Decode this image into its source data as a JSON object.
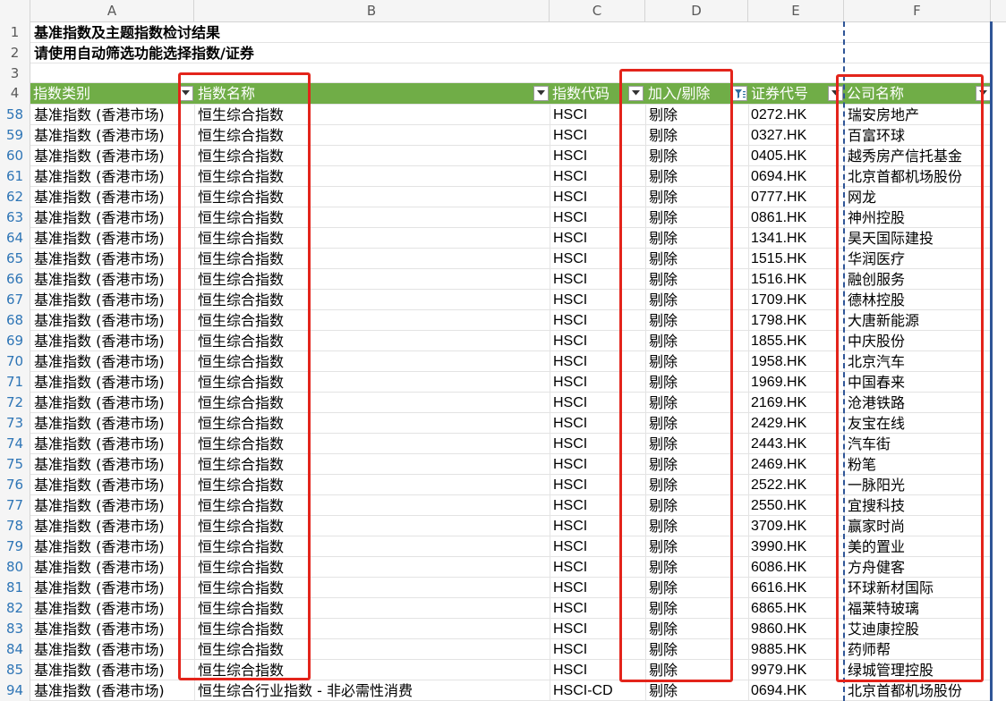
{
  "columns": [
    "A",
    "B",
    "C",
    "D",
    "E",
    "F"
  ],
  "title_rows": [
    {
      "num": "1",
      "text": "基准指数及主题指数检讨结果"
    },
    {
      "num": "2",
      "text": "请使用自动筛选功能选择指数/证券"
    },
    {
      "num": "3",
      "text": ""
    }
  ],
  "header": {
    "num": "4",
    "cells": [
      "指数类别",
      "指数名称",
      "指数代码",
      "加入/剔除",
      "证券代号",
      "公司名称"
    ],
    "filtered_column_index": 3
  },
  "rows": [
    {
      "num": "58",
      "category": "基准指数 (香港市场)",
      "index_name": "恒生综合指数",
      "index_code": "HSCI",
      "action": "剔除",
      "security_code": "0272.HK",
      "company": "瑞安房地产"
    },
    {
      "num": "59",
      "category": "基准指数 (香港市场)",
      "index_name": "恒生综合指数",
      "index_code": "HSCI",
      "action": "剔除",
      "security_code": "0327.HK",
      "company": "百富环球"
    },
    {
      "num": "60",
      "category": "基准指数 (香港市场)",
      "index_name": "恒生综合指数",
      "index_code": "HSCI",
      "action": "剔除",
      "security_code": "0405.HK",
      "company": "越秀房产信托基金"
    },
    {
      "num": "61",
      "category": "基准指数 (香港市场)",
      "index_name": "恒生综合指数",
      "index_code": "HSCI",
      "action": "剔除",
      "security_code": "0694.HK",
      "company": "北京首都机场股份"
    },
    {
      "num": "62",
      "category": "基准指数 (香港市场)",
      "index_name": "恒生综合指数",
      "index_code": "HSCI",
      "action": "剔除",
      "security_code": "0777.HK",
      "company": "网龙"
    },
    {
      "num": "63",
      "category": "基准指数 (香港市场)",
      "index_name": "恒生综合指数",
      "index_code": "HSCI",
      "action": "剔除",
      "security_code": "0861.HK",
      "company": "神州控股"
    },
    {
      "num": "64",
      "category": "基准指数 (香港市场)",
      "index_name": "恒生综合指数",
      "index_code": "HSCI",
      "action": "剔除",
      "security_code": "1341.HK",
      "company": "昊天国际建投"
    },
    {
      "num": "65",
      "category": "基准指数 (香港市场)",
      "index_name": "恒生综合指数",
      "index_code": "HSCI",
      "action": "剔除",
      "security_code": "1515.HK",
      "company": "华润医疗"
    },
    {
      "num": "66",
      "category": "基准指数 (香港市场)",
      "index_name": "恒生综合指数",
      "index_code": "HSCI",
      "action": "剔除",
      "security_code": "1516.HK",
      "company": "融创服务"
    },
    {
      "num": "67",
      "category": "基准指数 (香港市场)",
      "index_name": "恒生综合指数",
      "index_code": "HSCI",
      "action": "剔除",
      "security_code": "1709.HK",
      "company": "德林控股"
    },
    {
      "num": "68",
      "category": "基准指数 (香港市场)",
      "index_name": "恒生综合指数",
      "index_code": "HSCI",
      "action": "剔除",
      "security_code": "1798.HK",
      "company": "大唐新能源"
    },
    {
      "num": "69",
      "category": "基准指数 (香港市场)",
      "index_name": "恒生综合指数",
      "index_code": "HSCI",
      "action": "剔除",
      "security_code": "1855.HK",
      "company": "中庆股份"
    },
    {
      "num": "70",
      "category": "基准指数 (香港市场)",
      "index_name": "恒生综合指数",
      "index_code": "HSCI",
      "action": "剔除",
      "security_code": "1958.HK",
      "company": "北京汽车"
    },
    {
      "num": "71",
      "category": "基准指数 (香港市场)",
      "index_name": "恒生综合指数",
      "index_code": "HSCI",
      "action": "剔除",
      "security_code": "1969.HK",
      "company": "中国春来"
    },
    {
      "num": "72",
      "category": "基准指数 (香港市场)",
      "index_name": "恒生综合指数",
      "index_code": "HSCI",
      "action": "剔除",
      "security_code": "2169.HK",
      "company": "沧港铁路"
    },
    {
      "num": "73",
      "category": "基准指数 (香港市场)",
      "index_name": "恒生综合指数",
      "index_code": "HSCI",
      "action": "剔除",
      "security_code": "2429.HK",
      "company": "友宝在线"
    },
    {
      "num": "74",
      "category": "基准指数 (香港市场)",
      "index_name": "恒生综合指数",
      "index_code": "HSCI",
      "action": "剔除",
      "security_code": "2443.HK",
      "company": "汽车街"
    },
    {
      "num": "75",
      "category": "基准指数 (香港市场)",
      "index_name": "恒生综合指数",
      "index_code": "HSCI",
      "action": "剔除",
      "security_code": "2469.HK",
      "company": "粉笔"
    },
    {
      "num": "76",
      "category": "基准指数 (香港市场)",
      "index_name": "恒生综合指数",
      "index_code": "HSCI",
      "action": "剔除",
      "security_code": "2522.HK",
      "company": "一脉阳光"
    },
    {
      "num": "77",
      "category": "基准指数 (香港市场)",
      "index_name": "恒生综合指数",
      "index_code": "HSCI",
      "action": "剔除",
      "security_code": "2550.HK",
      "company": "宜搜科技"
    },
    {
      "num": "78",
      "category": "基准指数 (香港市场)",
      "index_name": "恒生综合指数",
      "index_code": "HSCI",
      "action": "剔除",
      "security_code": "3709.HK",
      "company": "赢家时尚"
    },
    {
      "num": "79",
      "category": "基准指数 (香港市场)",
      "index_name": "恒生综合指数",
      "index_code": "HSCI",
      "action": "剔除",
      "security_code": "3990.HK",
      "company": "美的置业"
    },
    {
      "num": "80",
      "category": "基准指数 (香港市场)",
      "index_name": "恒生综合指数",
      "index_code": "HSCI",
      "action": "剔除",
      "security_code": "6086.HK",
      "company": "方舟健客"
    },
    {
      "num": "81",
      "category": "基准指数 (香港市场)",
      "index_name": "恒生综合指数",
      "index_code": "HSCI",
      "action": "剔除",
      "security_code": "6616.HK",
      "company": "环球新材国际"
    },
    {
      "num": "82",
      "category": "基准指数 (香港市场)",
      "index_name": "恒生综合指数",
      "index_code": "HSCI",
      "action": "剔除",
      "security_code": "6865.HK",
      "company": "福莱特玻璃"
    },
    {
      "num": "83",
      "category": "基准指数 (香港市场)",
      "index_name": "恒生综合指数",
      "index_code": "HSCI",
      "action": "剔除",
      "security_code": "9860.HK",
      "company": "艾迪康控股"
    },
    {
      "num": "84",
      "category": "基准指数 (香港市场)",
      "index_name": "恒生综合指数",
      "index_code": "HSCI",
      "action": "剔除",
      "security_code": "9885.HK",
      "company": "药师帮"
    },
    {
      "num": "85",
      "category": "基准指数 (香港市场)",
      "index_name": "恒生综合指数",
      "index_code": "HSCI",
      "action": "剔除",
      "security_code": "9979.HK",
      "company": "绿城管理控股"
    },
    {
      "num": "94",
      "category": "基准指数 (香港市场)",
      "index_name": "恒生综合行业指数 - 非必需性消费",
      "index_code": "HSCI-CD",
      "action": "剔除",
      "security_code": "0694.HK",
      "company": "北京首都机场股份"
    }
  ],
  "colors": {
    "header_green": "#70ad47",
    "highlight_red": "#e3241b",
    "filtered_row_number": "#2e75b6"
  }
}
